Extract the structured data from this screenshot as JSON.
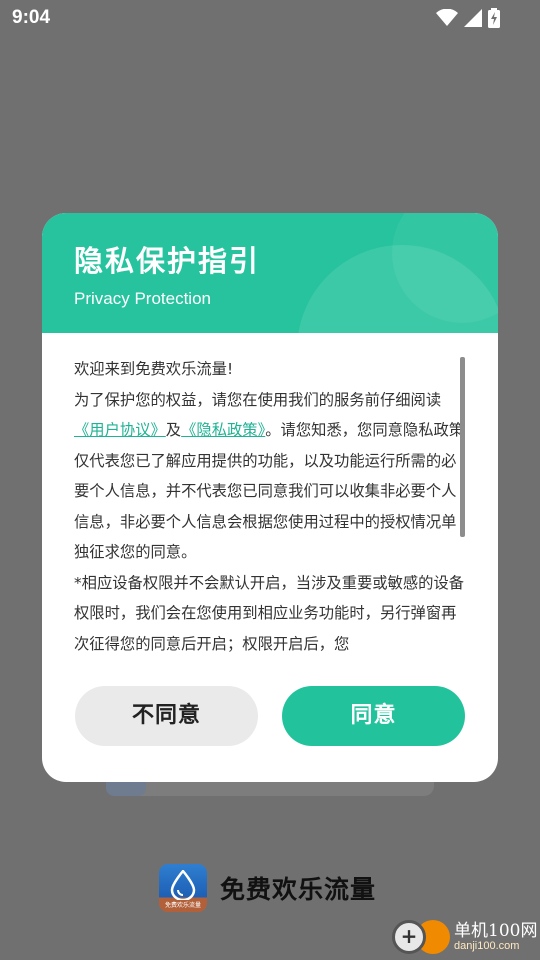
{
  "status_bar": {
    "time": "9:04"
  },
  "dialog": {
    "title": "隐私保护指引",
    "subtitle": "Privacy Protection",
    "body": {
      "line1": "欢迎来到免费欢乐流量!",
      "p2_before": "为了保护您的权益，请您在使用我们的服务前仔细阅读",
      "link_user_agreement": "《用户协议》",
      "and": "及",
      "link_privacy_policy": "《隐私政策》",
      "p2_after": "。请您知悉，您同意隐私政策仅代表您已了解应用提供的功能，以及功能运行所需的必要个人信息，并不代表您已同意我们可以收集非必要个人信息，非必要个人信息会根据您使用过程中的授权情况单独征求您的同意。",
      "p3": "*相应设备权限并不会默认开启，当涉及重要或敏感的设备权限时，我们会在您使用到相应业务功能时，另行弹窗再次征得您的同意后开启；权限开启后，您"
    },
    "buttons": {
      "disagree": "不同意",
      "agree": "同意"
    }
  },
  "app": {
    "name": "免费欢乐流量",
    "logo_text": "免费欢乐流量"
  },
  "watermark": {
    "title": "单机100网",
    "subtitle": "danji100.com"
  },
  "colors": {
    "accent": "#26c39e",
    "dim_overlay": "#707070",
    "link": "#1fb393"
  }
}
